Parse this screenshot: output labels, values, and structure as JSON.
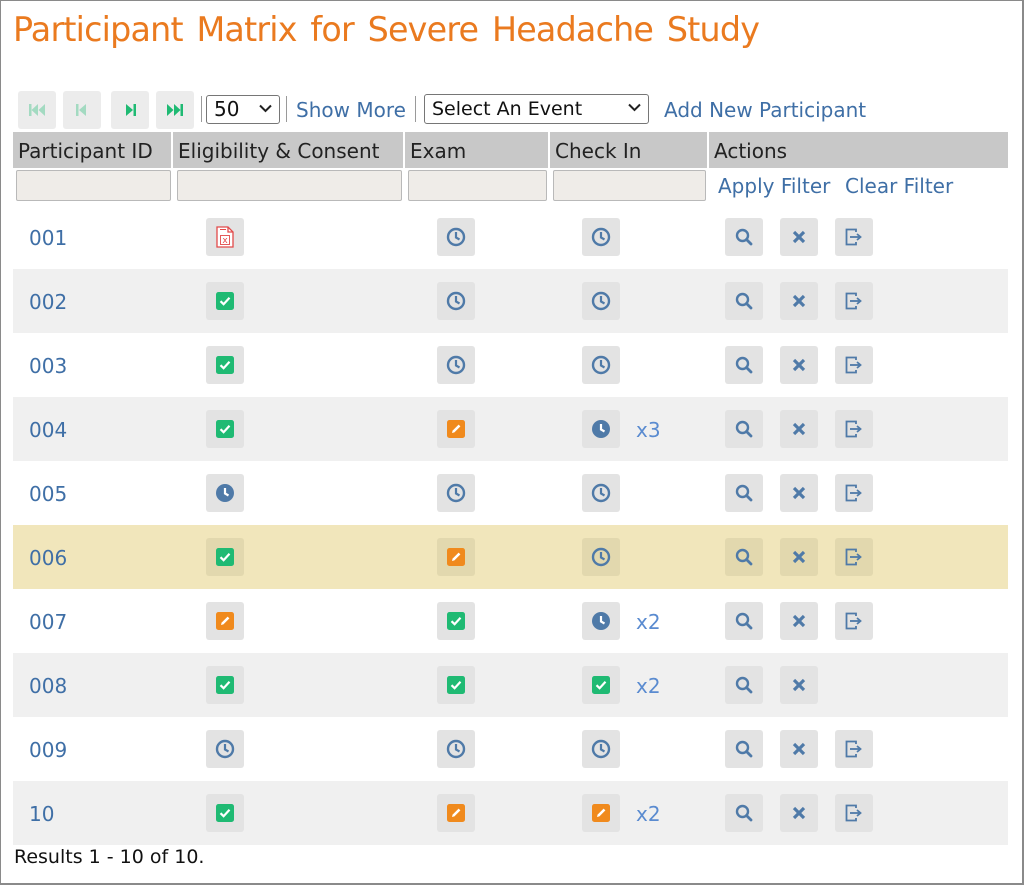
{
  "title": "Participant Matrix for Severe Headache Study",
  "toolbar": {
    "page_size": "50",
    "show_more": "Show More",
    "event_select": "Select An Event",
    "add_participant": "Add New Participant"
  },
  "columns": {
    "participant_id": "Participant ID",
    "eligibility": "Eligibility & Consent",
    "exam": "Exam",
    "checkin": "Check In",
    "actions": "Actions"
  },
  "filter": {
    "apply": "Apply Filter",
    "clear": "Clear Filter"
  },
  "rows": [
    {
      "id": "001",
      "eligibility": "pdf",
      "exam": "clock",
      "checkin": "clock",
      "checkin_count": "",
      "actions": [
        "search",
        "close",
        "exit"
      ],
      "highlight": false
    },
    {
      "id": "002",
      "eligibility": "check",
      "exam": "clock",
      "checkin": "clock",
      "checkin_count": "",
      "actions": [
        "search",
        "close",
        "exit"
      ],
      "highlight": false
    },
    {
      "id": "003",
      "eligibility": "check",
      "exam": "clock",
      "checkin": "clock",
      "checkin_count": "",
      "actions": [
        "search",
        "close",
        "exit"
      ],
      "highlight": false
    },
    {
      "id": "004",
      "eligibility": "check",
      "exam": "edit",
      "checkin": "clock-filled",
      "checkin_count": "x3",
      "actions": [
        "search",
        "close",
        "exit"
      ],
      "highlight": false
    },
    {
      "id": "005",
      "eligibility": "clock-filled",
      "exam": "clock",
      "checkin": "clock",
      "checkin_count": "",
      "actions": [
        "search",
        "close",
        "exit"
      ],
      "highlight": false
    },
    {
      "id": "006",
      "eligibility": "check",
      "exam": "edit",
      "checkin": "clock",
      "checkin_count": "",
      "actions": [
        "search",
        "close",
        "exit"
      ],
      "highlight": true
    },
    {
      "id": "007",
      "eligibility": "edit",
      "exam": "check",
      "checkin": "clock-filled",
      "checkin_count": "x2",
      "actions": [
        "search",
        "close",
        "exit"
      ],
      "highlight": false
    },
    {
      "id": "008",
      "eligibility": "check",
      "exam": "check",
      "checkin": "check",
      "checkin_count": "x2",
      "actions": [
        "search",
        "close"
      ],
      "highlight": false
    },
    {
      "id": "009",
      "eligibility": "clock",
      "exam": "clock",
      "checkin": "clock",
      "checkin_count": "",
      "actions": [
        "search",
        "close",
        "exit"
      ],
      "highlight": false
    },
    {
      "id": "10",
      "eligibility": "check",
      "exam": "edit",
      "checkin": "edit",
      "checkin_count": "x2",
      "actions": [
        "search",
        "close",
        "exit"
      ],
      "highlight": false
    }
  ],
  "results_text": "Results 1 - 10 of 10.",
  "colors": {
    "title": "#ea7a1f",
    "link": "#3f6fa6",
    "check": "#1fba73",
    "edit": "#f08a1d",
    "clock": "#4f7aa8",
    "pdf": "#e24a4a",
    "highlight_row": "#f1e6bb",
    "nav_icon": "#1fba73"
  }
}
